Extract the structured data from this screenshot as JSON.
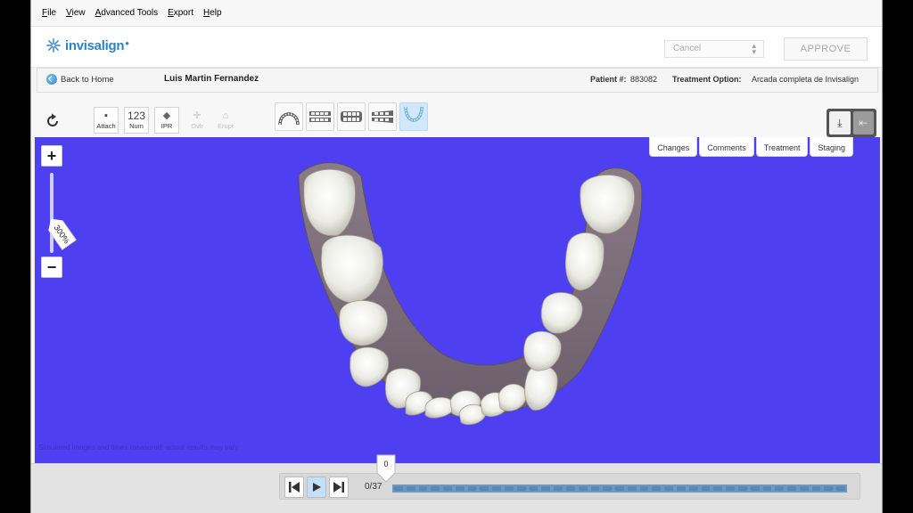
{
  "menu": {
    "items": [
      "File",
      "View",
      "Advanced Tools",
      "Export",
      "Help"
    ]
  },
  "header": {
    "logo_text": "invisalign",
    "cancel_label": "Cancel",
    "approve_label": "APPROVE"
  },
  "patient": {
    "back_label": "Back to Home",
    "name": "Luis Martin Fernandez",
    "number_label": "Patient #:",
    "number_value": "883082",
    "treatment_label": "Treatment Option:",
    "treatment_value": "Arcada completa de Invisalign"
  },
  "toolbar": {
    "tools": [
      {
        "icon": "attach-icon",
        "glyph": "▪",
        "label": "Attach",
        "enabled": true
      },
      {
        "icon": "number-icon",
        "glyph": "123",
        "label": "Num",
        "enabled": true
      },
      {
        "icon": "ipr-icon",
        "glyph": "◆",
        "label": "IPR",
        "enabled": true
      },
      {
        "icon": "overlay-icon",
        "glyph": "✛",
        "label": "Ovlr",
        "enabled": false
      },
      {
        "icon": "eruption-icon",
        "glyph": "⌂",
        "label": "Erupt",
        "enabled": false
      }
    ],
    "views": [
      "upper-arch-view",
      "front-view-1",
      "front-view-2",
      "front-view-3",
      "lower-arch-view"
    ],
    "active_view": "lower-arch-view"
  },
  "tabs": [
    "Changes",
    "Comments",
    "Treatment",
    "Staging"
  ],
  "zoom": {
    "plus": "+",
    "minus": "−",
    "level_label": "300%"
  },
  "viewport": {
    "background": "#4e40f1",
    "disclaimer": "Simulated images and times measured; actual results may vary"
  },
  "playback": {
    "current_stage": "0",
    "counter": "0/37",
    "total_stages": 37,
    "progress": 0
  },
  "colors": {
    "accent": "#2e83c8",
    "viewport": "#4e40f1"
  }
}
